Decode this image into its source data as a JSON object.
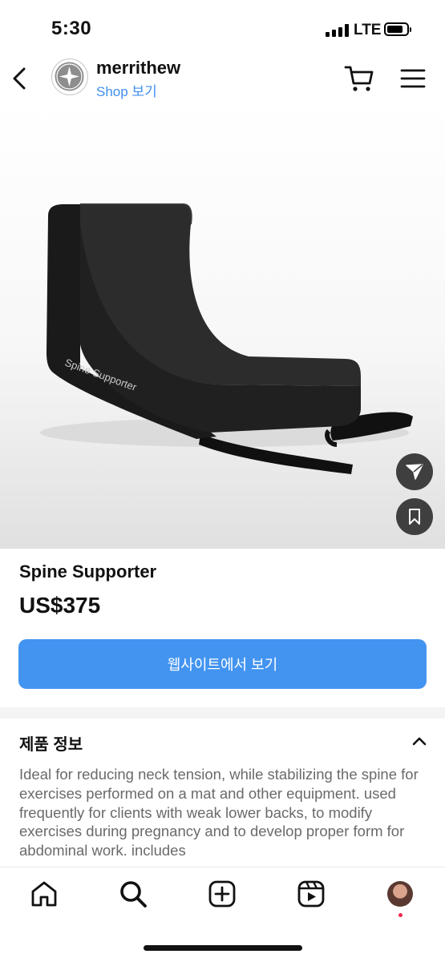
{
  "status_bar": {
    "time": "5:30",
    "network": "LTE",
    "signal_icon": "signal-bars-icon",
    "battery_icon": "battery-icon"
  },
  "header": {
    "shop_name": "merrithew",
    "shop_link": "Shop 보기",
    "icons": [
      "back-chevron-icon",
      "shop-logo-icon",
      "cart-icon",
      "menu-icon"
    ]
  },
  "hero": {
    "product_print": "Spine Supporter",
    "actions": [
      "share-icon",
      "bookmark-icon"
    ],
    "colors": {
      "product": "#1c1c1c",
      "background": "#f4f4f4",
      "fab": "#3f3f3f"
    }
  },
  "product": {
    "title": "Spine Supporter",
    "price": "US$375",
    "cta_label": "웹사이트에서 보기"
  },
  "info": {
    "section_title": "제품 정보",
    "description": "Ideal for reducing neck tension, while stabilizing the spine for exercises performed on a mat and other equipment. used frequently for clients with weak lower backs, to modify exercises during pregnancy and to develop proper form for abdominal work. includes"
  },
  "bottom_nav": {
    "items": [
      "home-icon",
      "search-icon",
      "create-post-icon",
      "reels-icon",
      "profile-avatar"
    ],
    "accent": "#4394f0",
    "notification_color": "#ee2a4a"
  }
}
